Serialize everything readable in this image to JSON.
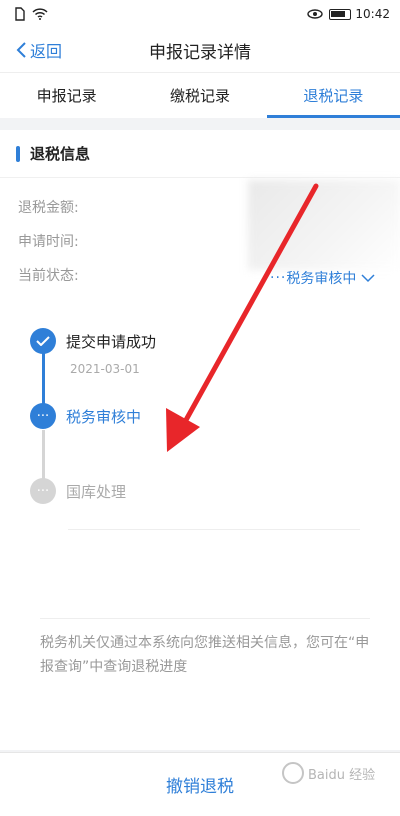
{
  "status_bar": {
    "time": "10:42"
  },
  "nav": {
    "back_label": "返回",
    "title": "申报记录详情"
  },
  "tabs": [
    {
      "label": "申报记录",
      "active": false
    },
    {
      "label": "缴税记录",
      "active": false
    },
    {
      "label": "退税记录",
      "active": true
    }
  ],
  "section": {
    "title": "退税信息"
  },
  "info": {
    "amount_label": "退税金额:",
    "time_label": "申请时间:",
    "status_label": "当前状态:",
    "status_value": "税务审核中"
  },
  "timeline": [
    {
      "label": "提交申请成功",
      "date": "2021-03-01",
      "state": "done"
    },
    {
      "label": "税务审核中",
      "state": "current"
    },
    {
      "label": "国库处理",
      "state": "pending"
    }
  ],
  "notice": "税务机关仅通过本系统向您推送相关信息，您可在“申报查询”中查询退税进度",
  "bottom": {
    "cancel_label": "撤销退税"
  },
  "watermark": {
    "text": "Baidu 经验"
  },
  "colors": {
    "accent": "#2f7fd8",
    "arrow": "#e8262a",
    "pending": "#d5d5d5"
  }
}
